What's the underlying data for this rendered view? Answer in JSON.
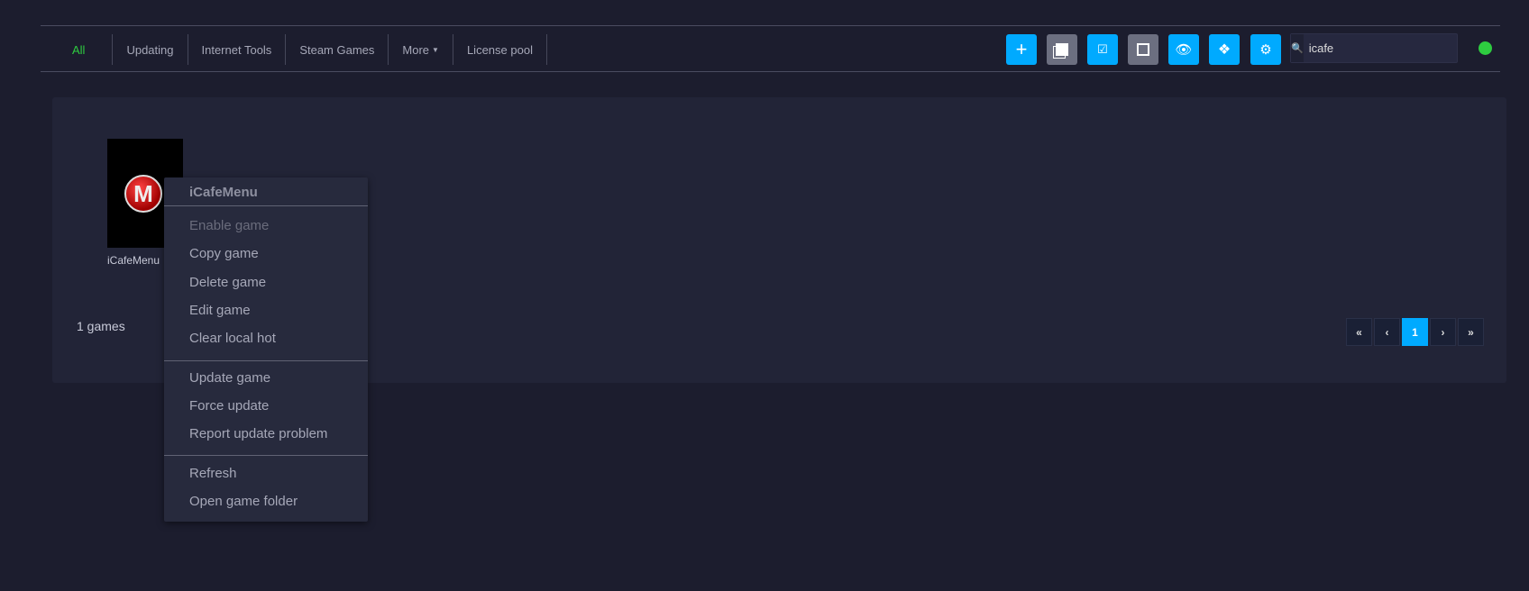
{
  "nav": {
    "tabs": [
      "All",
      "Updating",
      "Internet Tools",
      "Steam Games",
      "More",
      "License pool"
    ]
  },
  "toolbar": {
    "add": "+",
    "search_value": "icafe"
  },
  "game": {
    "name": "iCafeMenu",
    "logo_letter": "M"
  },
  "count_label": "1 games",
  "pager": [
    "«",
    "‹",
    "1",
    "›",
    "»"
  ],
  "menu": {
    "title": "iCafeMenu",
    "items": [
      "Enable game",
      "Copy game",
      "Delete game",
      "Edit game",
      "Clear local hot",
      "Update game",
      "Force update",
      "Report update problem",
      "Refresh",
      "Open game folder"
    ]
  },
  "colors": {
    "accent": "#00aaff",
    "active_tab": "#2ecc40"
  }
}
